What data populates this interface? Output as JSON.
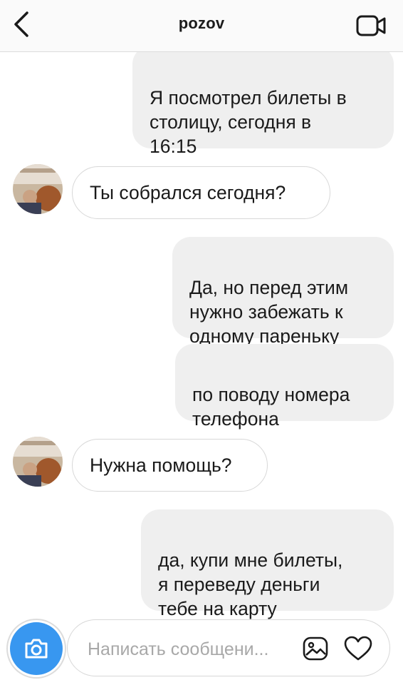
{
  "header": {
    "title": "pozov",
    "back_icon": "chevron-left-icon",
    "video_icon": "video-camera-icon"
  },
  "messages": [
    {
      "direction": "out",
      "text": "Я посмотрел билеты в\nстолицу, сегодня в\n16:15"
    },
    {
      "direction": "in",
      "text": "Ты собрался сегодня?"
    },
    {
      "direction": "out",
      "text": "Да, но перед этим\nнужно забежать к\nодному пареньку"
    },
    {
      "direction": "out",
      "text": "по поводу номера\nтелефона"
    },
    {
      "direction": "in",
      "text": "Нужна помощь?"
    },
    {
      "direction": "out",
      "text": "да, купи мне билеты,\nя переведу деньги\nтебе на карту"
    }
  ],
  "composer": {
    "placeholder": "Написать сообщени...",
    "value": "",
    "camera_icon": "camera-icon",
    "gallery_icon": "gallery-icon",
    "heart_icon": "heart-icon"
  },
  "colors": {
    "outgoing_bubble": "#efefef",
    "incoming_bubble_border": "#d8d8d8",
    "camera_button": "#3897f0"
  }
}
